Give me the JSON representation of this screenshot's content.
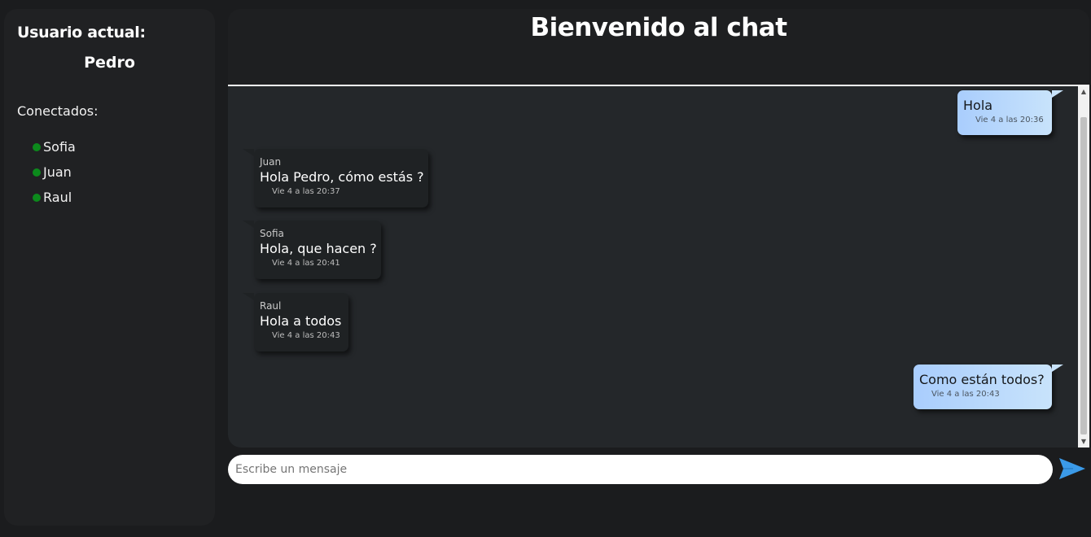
{
  "sidebar": {
    "current_user_label": "Usuario actual:",
    "current_user": "Pedro",
    "connected_label": "Conectados:",
    "users": [
      "Sofia",
      "Juan",
      "Raul"
    ],
    "online_color": "#0c8a1c"
  },
  "header": {
    "title": "Bienvenido al chat"
  },
  "messages": [
    {
      "direction": "out",
      "text": "Hola",
      "time": "Vie 4 a las 20:36"
    },
    {
      "direction": "in",
      "sender": "Juan",
      "text": "Hola Pedro, cómo estás ?",
      "time": "Vie 4 a las 20:37"
    },
    {
      "direction": "in",
      "sender": "Sofia",
      "text": "Hola, que hacen ?",
      "time": "Vie 4 a las 20:41"
    },
    {
      "direction": "in",
      "sender": "Raul",
      "text": "Hola a todos",
      "time": "Vie 4 a las 20:43"
    },
    {
      "direction": "out",
      "text": "Como están todos?",
      "time": "Vie 4 a las 20:43"
    }
  ],
  "composer": {
    "placeholder": "Escribe un mensaje",
    "value": "",
    "send_icon": "send-icon"
  },
  "colors": {
    "outgoing_bubble": "#a9cdfd",
    "incoming_bubble": "#1f2224",
    "send_icon": "#3b9ae8"
  }
}
